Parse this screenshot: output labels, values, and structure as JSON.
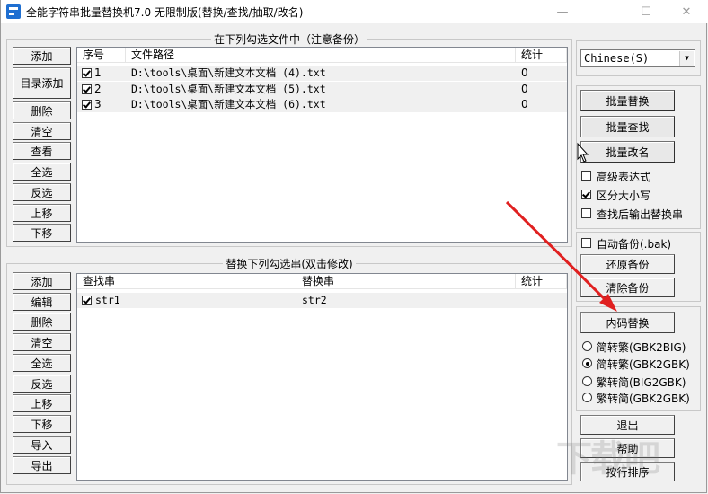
{
  "window": {
    "title": "全能字符串批量替换机7.0 无限制版(替换/查找/抽取/改名)",
    "minimize_glyph": "—",
    "maximize_glyph": "☐",
    "close_glyph": "✕"
  },
  "files_group": {
    "legend": "在下列勾选文件中（注意备份）",
    "buttons": [
      "添加",
      "目录添加",
      "删除",
      "清空",
      "查看",
      "全选",
      "反选",
      "上移",
      "下移"
    ],
    "columns": [
      "序号",
      "文件路径",
      "统计"
    ],
    "rows": [
      {
        "checked": true,
        "index": "1",
        "path": "D:\\tools\\桌面\\新建文本文档 (4).txt",
        "count": "0"
      },
      {
        "checked": true,
        "index": "2",
        "path": "D:\\tools\\桌面\\新建文本文档 (5).txt",
        "count": "0"
      },
      {
        "checked": true,
        "index": "3",
        "path": "D:\\tools\\桌面\\新建文本文档 (6).txt",
        "count": "0"
      }
    ]
  },
  "replace_group": {
    "legend": "替换下列勾选串(双击修改)",
    "buttons": [
      "添加",
      "编辑",
      "删除",
      "清空",
      "全选",
      "反选",
      "上移",
      "下移",
      "导入",
      "导出"
    ],
    "columns": [
      "查找串",
      "替换串",
      "统计"
    ],
    "rows": [
      {
        "checked": true,
        "find": "str1",
        "replace": "str2",
        "count": ""
      }
    ]
  },
  "language": {
    "selected": "Chinese(S)"
  },
  "actions": {
    "batch_replace": "批量替换",
    "batch_find": "批量查找",
    "batch_rename": "批量改名",
    "regex_label": "高级表达式",
    "regex_checked": false,
    "case_label": "区分大小写",
    "case_checked": true,
    "output_label": "查找后输出替换串",
    "output_checked": false
  },
  "backup": {
    "auto_label": "自动备份(.bak)",
    "auto_checked": false,
    "restore": "还原备份",
    "clear": "清除备份"
  },
  "encoding": {
    "button": "内码替换",
    "options": [
      {
        "label": "简转繁(GBK2BIG)",
        "selected": false
      },
      {
        "label": "简转繁(GBK2GBK)",
        "selected": true
      },
      {
        "label": "繁转简(BIG2GBK)",
        "selected": false
      },
      {
        "label": "繁转简(GBK2GBK)",
        "selected": false
      }
    ]
  },
  "bottom_buttons": {
    "exit": "退出",
    "help": "帮助",
    "sort": "按行排序"
  },
  "watermark": "下载吧",
  "colors": {
    "annotation_arrow": "#e02020"
  }
}
